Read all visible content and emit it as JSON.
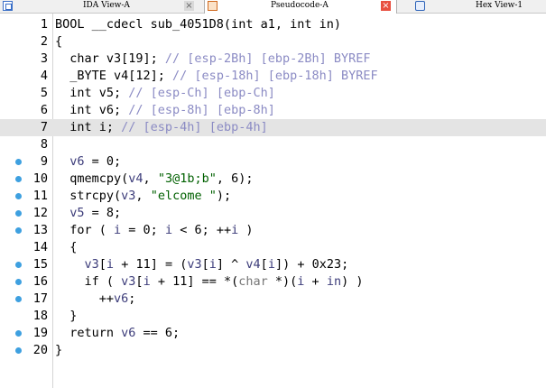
{
  "tabs": [
    {
      "label": "IDA View-A",
      "icon": "ida-view-icon",
      "close": "×"
    },
    {
      "label": "Pseudocode-A",
      "icon": "pseudocode-icon",
      "close": "×",
      "active": true
    },
    {
      "label": "Hex View-1",
      "icon": "hex-view-icon"
    }
  ],
  "breakpoint_color": "#3ea0e0",
  "code": {
    "lines": [
      {
        "n": "1",
        "bp": false,
        "t": [
          [
            "BOOL __cdecl sub_4051D8(int a1, int in)",
            ""
          ]
        ]
      },
      {
        "n": "2",
        "bp": false,
        "t": [
          [
            "{",
            ""
          ]
        ]
      },
      {
        "n": "3",
        "bp": false,
        "t": [
          [
            "  char v3[19]; ",
            ""
          ],
          [
            "// [esp-2Bh] [ebp-2Bh] BYREF",
            "c"
          ]
        ]
      },
      {
        "n": "4",
        "bp": false,
        "t": [
          [
            "  _BYTE v4[12]; ",
            ""
          ],
          [
            "// [esp-18h] [ebp-18h] BYREF",
            "c"
          ]
        ]
      },
      {
        "n": "5",
        "bp": false,
        "t": [
          [
            "  int v5; ",
            ""
          ],
          [
            "// [esp-Ch] [ebp-Ch]",
            "c"
          ]
        ]
      },
      {
        "n": "6",
        "bp": false,
        "t": [
          [
            "  int v6; ",
            ""
          ],
          [
            "// [esp-8h] [ebp-8h]",
            "c"
          ]
        ]
      },
      {
        "n": "7",
        "bp": false,
        "hl": true,
        "t": [
          [
            "  int i; ",
            ""
          ],
          [
            "// [esp-4h] [ebp-4h]",
            "c"
          ]
        ]
      },
      {
        "n": "8",
        "bp": false,
        "t": []
      },
      {
        "n": "9",
        "bp": true,
        "t": [
          [
            "  ",
            ""
          ],
          [
            "v6",
            "v"
          ],
          [
            " = 0;",
            ""
          ]
        ]
      },
      {
        "n": "10",
        "bp": true,
        "t": [
          [
            "  qmemcpy(",
            ""
          ],
          [
            "v4",
            "v"
          ],
          [
            ", ",
            ""
          ],
          [
            "\"3@1b;b\"",
            "s"
          ],
          [
            ", 6);",
            ""
          ]
        ]
      },
      {
        "n": "11",
        "bp": true,
        "t": [
          [
            "  strcpy(",
            ""
          ],
          [
            "v3",
            "v"
          ],
          [
            ", ",
            ""
          ],
          [
            "\"elcome \"",
            "s"
          ],
          [
            ");",
            ""
          ]
        ]
      },
      {
        "n": "12",
        "bp": true,
        "t": [
          [
            "  ",
            ""
          ],
          [
            "v5",
            "v"
          ],
          [
            " = 8;",
            ""
          ]
        ]
      },
      {
        "n": "13",
        "bp": true,
        "t": [
          [
            "  for ( ",
            ""
          ],
          [
            "i",
            "v"
          ],
          [
            " = 0; ",
            ""
          ],
          [
            "i",
            "v"
          ],
          [
            " < 6; ++",
            ""
          ],
          [
            "i",
            "v"
          ],
          [
            " )",
            ""
          ]
        ]
      },
      {
        "n": "14",
        "bp": false,
        "t": [
          [
            "  {",
            ""
          ]
        ]
      },
      {
        "n": "15",
        "bp": true,
        "t": [
          [
            "    ",
            ""
          ],
          [
            "v3",
            "v"
          ],
          [
            "[",
            ""
          ],
          [
            "i",
            "v"
          ],
          [
            " + 11] = (",
            ""
          ],
          [
            "v3",
            "v"
          ],
          [
            "[",
            ""
          ],
          [
            "i",
            "v"
          ],
          [
            "] ^ ",
            ""
          ],
          [
            "v4",
            "v"
          ],
          [
            "[",
            ""
          ],
          [
            "i",
            "v"
          ],
          [
            "]) + 0x23;",
            ""
          ]
        ]
      },
      {
        "n": "16",
        "bp": true,
        "t": [
          [
            "    if ( ",
            ""
          ],
          [
            "v3",
            "v"
          ],
          [
            "[",
            ""
          ],
          [
            "i",
            "v"
          ],
          [
            " + 11] == *(",
            ""
          ],
          [
            "char",
            "gr"
          ],
          [
            " *)(",
            ""
          ],
          [
            "i",
            "v"
          ],
          [
            " + ",
            ""
          ],
          [
            "in",
            "v"
          ],
          [
            ") )",
            ""
          ]
        ]
      },
      {
        "n": "17",
        "bp": true,
        "t": [
          [
            "      ++",
            ""
          ],
          [
            "v6",
            "v"
          ],
          [
            ";",
            ""
          ]
        ]
      },
      {
        "n": "18",
        "bp": false,
        "t": [
          [
            "  }",
            ""
          ]
        ]
      },
      {
        "n": "19",
        "bp": true,
        "t": [
          [
            "  return ",
            ""
          ],
          [
            "v6",
            "v"
          ],
          [
            " == 6;",
            ""
          ]
        ]
      },
      {
        "n": "20",
        "bp": true,
        "t": [
          [
            "}",
            ""
          ]
        ]
      }
    ]
  }
}
